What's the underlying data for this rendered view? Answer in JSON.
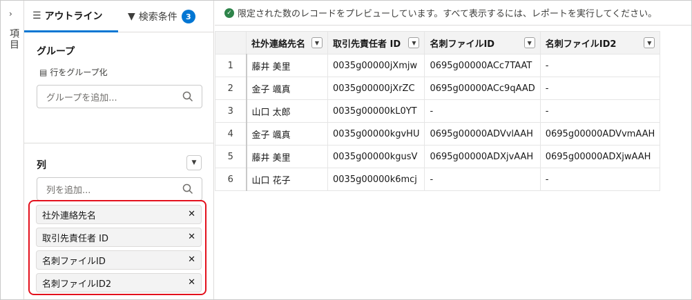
{
  "rail": {
    "label": "項目"
  },
  "tabs": [
    {
      "label": "アウトライン",
      "active": true
    },
    {
      "label": "検索条件",
      "badge": "3",
      "active": false
    }
  ],
  "group": {
    "title": "グループ",
    "row_group_label": "行をグループ化",
    "placeholder": "グループを追加..."
  },
  "columns": {
    "title": "列",
    "placeholder": "列を追加...",
    "items": [
      "社外連絡先名",
      "取引先責任者 ID",
      "名刺ファイルID",
      "名刺ファイルID2"
    ]
  },
  "notice": "限定された数のレコードをプレビューしています。すべて表示するには、レポートを実行してください。",
  "table": {
    "headers": [
      "社外連絡先名",
      "取引先責任者 ID",
      "名刺ファイルID",
      "名刺ファイルID2"
    ],
    "rows": [
      [
        "1",
        "藤井 美里",
        "0035g00000jXmjw",
        "0695g00000ACc7TAAT",
        "-"
      ],
      [
        "2",
        "金子 颯真",
        "0035g00000jXrZC",
        "0695g00000ACc9qAAD",
        "-"
      ],
      [
        "3",
        "山口 太郎",
        "0035g00000kL0YT",
        "-",
        "-"
      ],
      [
        "4",
        "金子 颯真",
        "0035g00000kgvHU",
        "0695g00000ADVvlAAH",
        "0695g00000ADVvmAAH"
      ],
      [
        "5",
        "藤井 美里",
        "0035g00000kgusV",
        "0695g00000ADXjvAAH",
        "0695g00000ADXjwAAH"
      ],
      [
        "6",
        "山口 花子",
        "0035g00000k6mcj",
        "-",
        "-"
      ]
    ]
  },
  "colors": {
    "accent": "#0176d3",
    "highlight": "#e3101c",
    "success": "#2e844a"
  }
}
